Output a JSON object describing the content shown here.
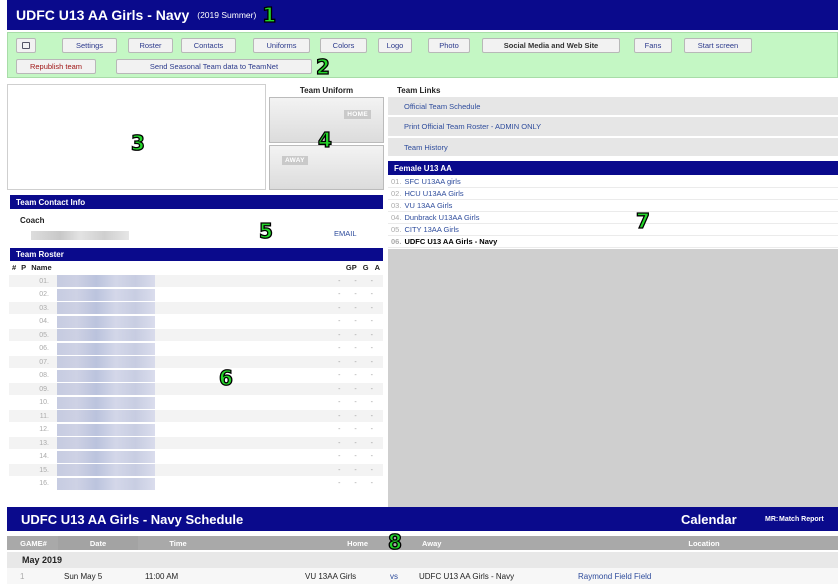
{
  "header": {
    "title": "UDFC U13 AA Girls - Navy",
    "season": "(2019 Summer)",
    "marker": "1"
  },
  "toolbar": {
    "row1": [
      "Settings",
      "Roster",
      "Contacts",
      "Uniforms",
      "Colors",
      "Logo",
      "Photo",
      "Social Media and Web Site",
      "Fans",
      "Start screen"
    ],
    "republish": "Republish team",
    "send": "Send Seasonal Team data to TeamNet",
    "marker": "2"
  },
  "photo": {
    "marker": "3"
  },
  "uniform": {
    "title": "Team Uniform",
    "home": "HOME",
    "away": "AWAY",
    "marker": "4"
  },
  "links": {
    "title": "Team Links",
    "items": [
      "Official Team Schedule",
      "Print Official Team Roster - ADMIN ONLY",
      "Team History"
    ]
  },
  "contact": {
    "title": "Team Contact Info",
    "role": "Coach",
    "email": "EMAIL",
    "marker": "5"
  },
  "standings": {
    "title": "Female U13 AA",
    "teams": [
      {
        "n": "01.",
        "name": "SFC U13AA girls"
      },
      {
        "n": "02.",
        "name": "HCU U13AA Girls"
      },
      {
        "n": "03.",
        "name": "VU 13AA Girls"
      },
      {
        "n": "04.",
        "name": "Dunbrack U13AA Girls"
      },
      {
        "n": "05.",
        "name": "CITY 13AA Girls"
      },
      {
        "n": "06.",
        "name": "UDFC U13 AA Girls - Navy"
      }
    ],
    "marker": "7"
  },
  "roster": {
    "title": "Team Roster",
    "cols": {
      "num": "#",
      "pos": "P",
      "name": "Name",
      "gp": "GP",
      "g": "G",
      "a": "A"
    },
    "rows": [
      "01.",
      "02.",
      "03.",
      "04.",
      "05.",
      "06.",
      "07.",
      "08.",
      "09.",
      "10.",
      "11.",
      "12.",
      "13.",
      "14.",
      "15.",
      "16."
    ],
    "stat": "- - -",
    "marker": "6"
  },
  "schedule": {
    "title": "UDFC U13 AA Girls - Navy Schedule",
    "calendar": "Calendar",
    "mr_key": "MR:",
    "mr_label": "Match Report",
    "cols": {
      "game": "GAME#",
      "date": "Date",
      "time": "Time",
      "home": "Home",
      "away": "Away",
      "location": "Location"
    },
    "month": "May 2019",
    "games": [
      {
        "num": "1",
        "date": "Sun May 5",
        "time": "11:00 AM",
        "home": "VU 13AA Girls",
        "vs": "vs",
        "away": "UDFC U13 AA Girls - Navy",
        "location": "Raymond Field Field"
      }
    ],
    "marker": "8"
  }
}
